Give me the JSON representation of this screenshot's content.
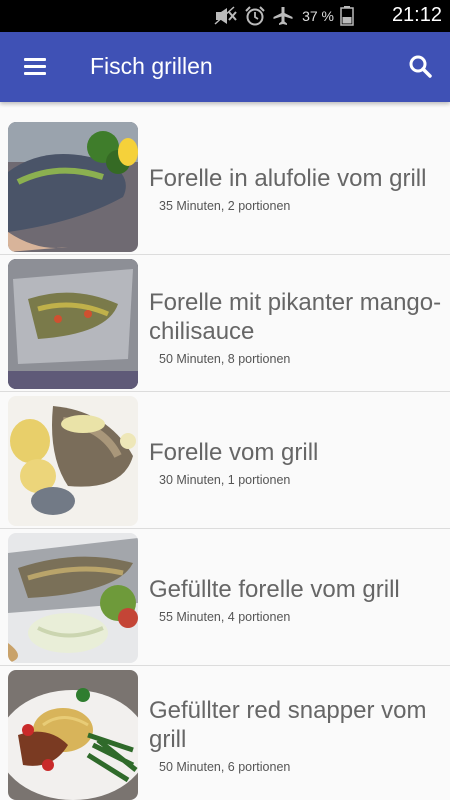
{
  "status_bar": {
    "battery_percent": "37 %",
    "time": "21:12",
    "icons": [
      "mute-icon",
      "alarm-icon",
      "airplane-mode-icon",
      "battery-icon"
    ]
  },
  "app_bar": {
    "title": "Fisch grillen",
    "icons": [
      "menu-icon",
      "search-icon"
    ]
  },
  "recipes": [
    {
      "title": "Forelle in alufolie vom grill",
      "meta": "35 Minuten, 2 portionen"
    },
    {
      "title": "Forelle mit pikanter mango-chilisauce",
      "meta": "50 Minuten, 8 portionen"
    },
    {
      "title": "Forelle vom grill",
      "meta": "30 Minuten, 1 portionen"
    },
    {
      "title": "Gefüllte forelle vom grill",
      "meta": "55 Minuten, 4 portionen"
    },
    {
      "title": "Gefüllter red snapper vom grill",
      "meta": "50 Minuten, 6 portionen"
    }
  ]
}
